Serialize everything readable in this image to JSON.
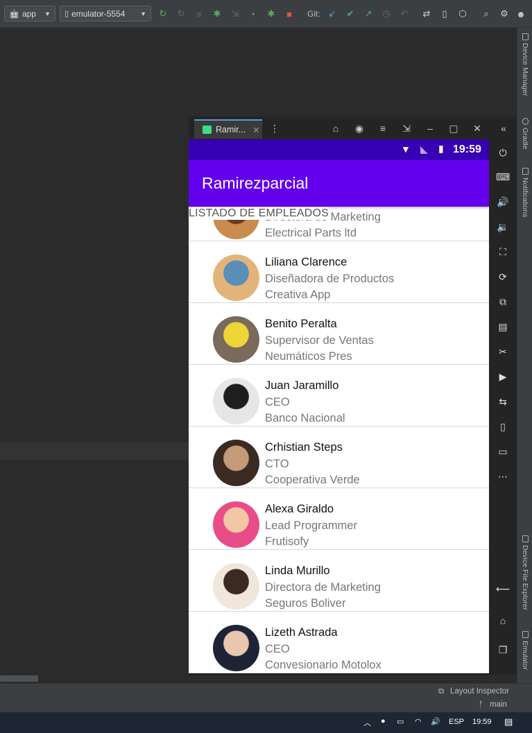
{
  "ide": {
    "run_config": "app",
    "device": "emulator-5554",
    "git_label": "Git:",
    "side_tabs": [
      "Device Manager",
      "Gradle",
      "Notifications",
      "Device File Explorer",
      "Emulator"
    ],
    "status": {
      "layout_inspector": "Layout Inspector",
      "branch": "main"
    }
  },
  "emulator": {
    "tab_title": "Ramir...",
    "clock": "19:59"
  },
  "app": {
    "title": "Ramirezparcial",
    "heading": "LISTADO DE EMPLEADOS",
    "employees": [
      {
        "name": "",
        "role": "Directora de Marketing",
        "company": "Electrical Parts ltd",
        "colors": [
          "#c98b4e",
          "#6a3b1f"
        ]
      },
      {
        "name": "Liliana Clarence",
        "role": "Diseñadora de Productos",
        "company": "Creativa App",
        "colors": [
          "#e3b47a",
          "#5a8fb8"
        ]
      },
      {
        "name": "Benito Peralta",
        "role": "Supervisor de Ventas",
        "company": "Neumáticos Pres",
        "colors": [
          "#7a6a5c",
          "#f0d53a"
        ]
      },
      {
        "name": "Juan Jaramillo",
        "role": "CEO",
        "company": "Banco Nacional",
        "colors": [
          "#e6e6e6",
          "#1e1e1e"
        ]
      },
      {
        "name": "Crhistian Steps",
        "role": "CTO",
        "company": "Cooperativa Verde",
        "colors": [
          "#3a2a22",
          "#c49a78"
        ]
      },
      {
        "name": "Alexa Giraldo",
        "role": "Lead Programmer",
        "company": "Frutisofy",
        "colors": [
          "#e84d8a",
          "#f2c7a5"
        ]
      },
      {
        "name": "Linda Murillo",
        "role": "Directora de Marketing",
        "company": "Seguros Boliver",
        "colors": [
          "#f0e6dc",
          "#3a2a22"
        ]
      },
      {
        "name": "Lizeth Astrada",
        "role": "CEO",
        "company": "Convesionario Motolox",
        "colors": [
          "#1e2436",
          "#e8c6b0"
        ]
      }
    ]
  },
  "taskbar": {
    "lang": "ESP",
    "time": "19:59"
  }
}
